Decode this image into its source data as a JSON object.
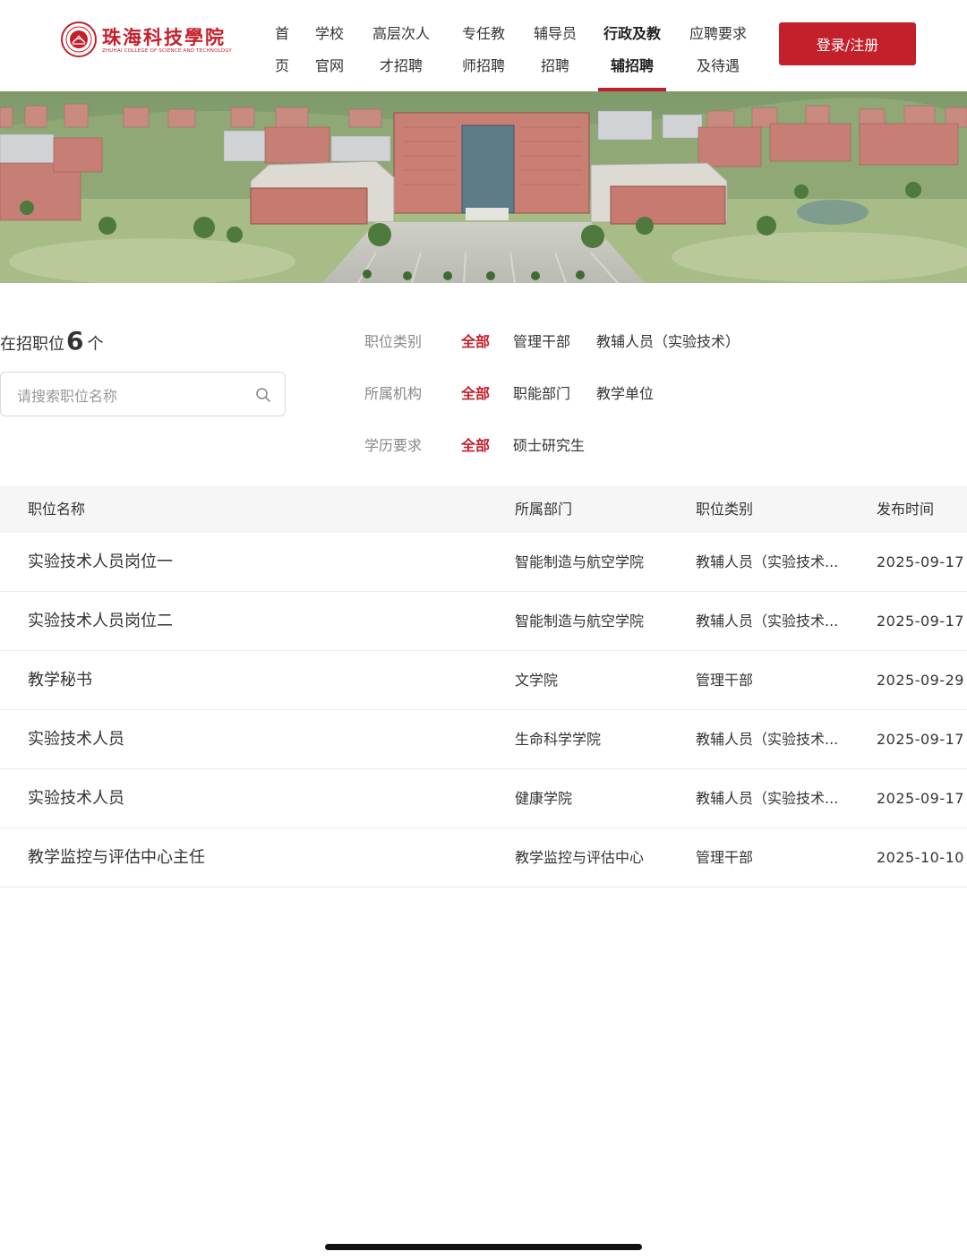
{
  "header": {
    "logo": {
      "name_cn": "珠海科技學院",
      "name_en": "ZHUHAI COLLEGE OF SCIENCE AND TECHNOLOGY"
    },
    "nav": [
      {
        "line1": "首",
        "line2": "页",
        "active": false
      },
      {
        "line1": "学校",
        "line2": "官网",
        "active": false
      },
      {
        "line1": "高层次人",
        "line2": "才招聘",
        "active": false
      },
      {
        "line1": "专任教",
        "line2": "师招聘",
        "active": false
      },
      {
        "line1": "辅导员",
        "line2": "招聘",
        "active": false
      },
      {
        "line1": "行政及教",
        "line2": "辅招聘",
        "active": true
      },
      {
        "line1": "应聘要求",
        "line2": "及待遇",
        "active": false
      }
    ],
    "login_label": "登录/注册"
  },
  "filters": {
    "count_prefix": "在招职位",
    "count": "6",
    "count_suffix": "个",
    "search_placeholder": "请搜索职位名称",
    "groups": [
      {
        "label": "职位类别",
        "options": [
          "全部",
          "管理干部",
          "教辅人员（实验技术）"
        ],
        "selected": "全部"
      },
      {
        "label": "所属机构",
        "options": [
          "全部",
          "职能部门",
          "教学单位"
        ],
        "selected": "全部"
      },
      {
        "label": "学历要求",
        "options": [
          "全部",
          "硕士研究生"
        ],
        "selected": "全部"
      }
    ]
  },
  "table": {
    "headers": [
      "职位名称",
      "所属部门",
      "职位类别",
      "发布时间"
    ],
    "rows": [
      {
        "name": "实验技术人员岗位一",
        "dept": "智能制造与航空学院",
        "category": "教辅人员（实验技术...",
        "date": "2025-09-17"
      },
      {
        "name": "实验技术人员岗位二",
        "dept": "智能制造与航空学院",
        "category": "教辅人员（实验技术...",
        "date": "2025-09-17"
      },
      {
        "name": "教学秘书",
        "dept": "文学院",
        "category": "管理干部",
        "date": "2025-09-29"
      },
      {
        "name": "实验技术人员",
        "dept": "生命科学学院",
        "category": "教辅人员（实验技术...",
        "date": "2025-09-17"
      },
      {
        "name": "实验技术人员",
        "dept": "健康学院",
        "category": "教辅人员（实验技术...",
        "date": "2025-09-17"
      },
      {
        "name": "教学监控与评估中心主任",
        "dept": "教学监控与评估中心",
        "category": "管理干部",
        "date": "2025-10-10"
      }
    ]
  },
  "colors": {
    "brand": "#c4202c",
    "active_underline": "#b8222a",
    "table_header_bg": "#f6f6f6",
    "muted_label": "#888888"
  },
  "icons": {
    "logo": "school-emblem-icon",
    "search": "search-icon"
  }
}
